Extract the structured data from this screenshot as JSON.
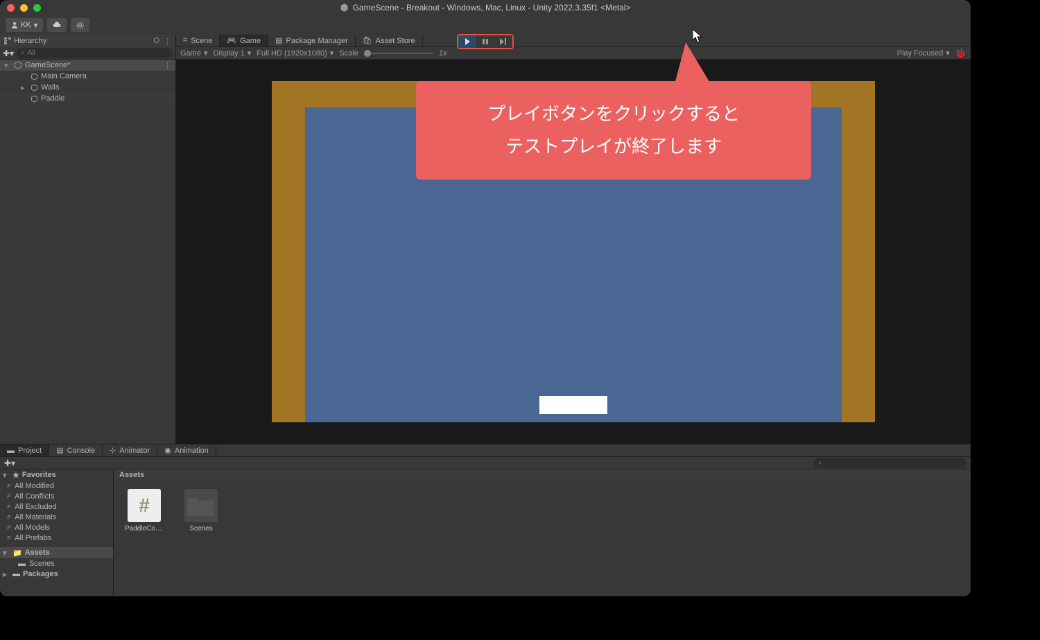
{
  "title": "GameScene - Breakout - Windows, Mac, Linux - Unity 2022.3.35f1 <Metal>",
  "account": "KK",
  "hierarchy": {
    "title": "Hierarchy",
    "search_placeholder": "All",
    "scene": "GameScene*",
    "items": [
      "Main Camera",
      "Walls",
      "Paddle"
    ]
  },
  "tabs_top": {
    "scene": "Scene",
    "game": "Game",
    "pkg": "Package Manager",
    "store": "Asset Store"
  },
  "game_toolbar": {
    "mode": "Game",
    "display": "Display 1",
    "res": "Full HD (1920x1080)",
    "scale_label": "Scale",
    "scale_value": "1x",
    "play_mode": "Play Focused"
  },
  "callout": {
    "line1": "プレイボタンをクリックすると",
    "line2": "テストプレイが終了します"
  },
  "project": {
    "tabs": {
      "project": "Project",
      "console": "Console",
      "animator": "Animator",
      "animation": "Animation"
    },
    "favorites_label": "Favorites",
    "favorites": [
      "All Modified",
      "All Conflicts",
      "All Excluded",
      "All Materials",
      "All Models",
      "All Prefabs"
    ],
    "assets_folder": "Assets",
    "subfolders": [
      "Scenes"
    ],
    "packages": "Packages",
    "assets_header": "Assets",
    "items": [
      {
        "name": "PaddleCon...",
        "type": "script"
      },
      {
        "name": "Scenes",
        "type": "folder"
      }
    ]
  }
}
